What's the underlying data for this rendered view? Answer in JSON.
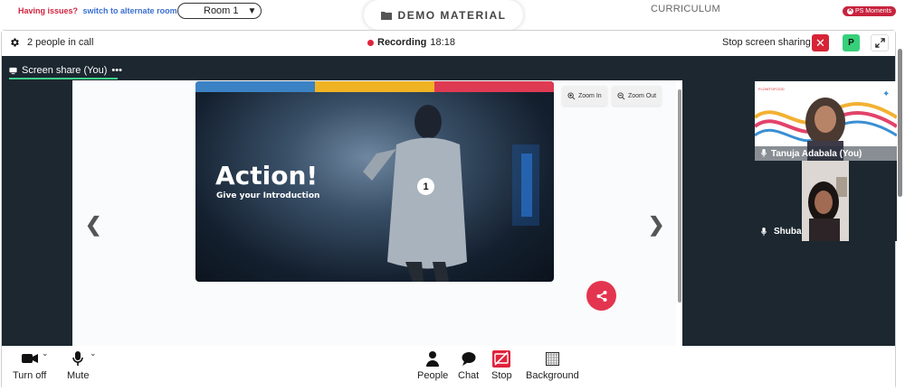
{
  "top": {
    "issues_question": "Having issues?",
    "issues_link": "switch to alternate room",
    "room_label": "Room 1",
    "tab_label": "DEMO MATERIAL",
    "curriculum_label": "CURRICULUM",
    "moments_label": "PS Moments"
  },
  "callbar": {
    "people_count": "2 people in call",
    "recording_label": "Recording",
    "recording_time": "18:18",
    "stop_sharing_label": "Stop screen sharing",
    "avatar_letter": "P"
  },
  "stage": {
    "tab_label": "Screen share (You)",
    "tab_more": "•••",
    "zoom_in_label": "Zoom In",
    "zoom_out_label": "Zoom Out"
  },
  "slide": {
    "title": "Action!",
    "subtitle": "Give your Introduction",
    "number": "1",
    "strip_colors": [
      "#3b82c4",
      "#f0b323",
      "#df3a54"
    ]
  },
  "participants": [
    {
      "name": "Tanuja Adabala (You)",
      "icon": "mic-icon"
    },
    {
      "name": "Shuba",
      "icon": "mic-icon"
    }
  ],
  "toolbar": {
    "turn_off_label": "Turn off",
    "mute_label": "Mute",
    "people_label": "People",
    "chat_label": "Chat",
    "stop_label": "Stop",
    "background_label": "Background"
  },
  "colors": {
    "accent_red": "#e0233c",
    "accent_green": "#3fd08a",
    "stage_bg": "#1c2730"
  }
}
